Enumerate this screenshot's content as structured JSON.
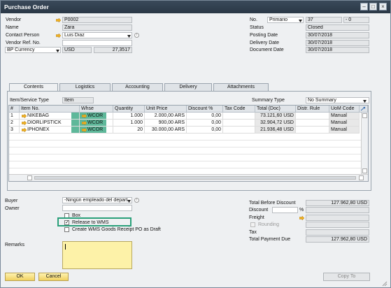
{
  "window": {
    "title": "Purchase Order"
  },
  "header_left": {
    "vendor_label": "Vendor",
    "vendor_value": "P0002",
    "name_label": "Name",
    "name_value": "Zara",
    "contact_label": "Contact Person",
    "contact_value": "Luis Diaz",
    "ref_label": "Vendor Ref. No.",
    "ref_value": "",
    "currency_label": "BP Currency",
    "currency_code": "USD",
    "currency_rate": "27,3517"
  },
  "header_right": {
    "no_label": "No.",
    "series_value": "Primario",
    "no_value": "37",
    "no_suffix": "- 0",
    "status_label": "Status",
    "status_value": "Closed",
    "posting_label": "Posting Date",
    "posting_value": "30/07/2018",
    "delivery_label": "Delivery Date",
    "delivery_value": "30/07/2018",
    "doc_label": "Document Date",
    "doc_value": "30/07/2018"
  },
  "tabs": [
    "Contents",
    "Logistics",
    "Accounting",
    "Delivery",
    "Attachments"
  ],
  "contents": {
    "item_type_label": "Item/Service Type",
    "item_type_value": "Item",
    "summary_label": "Summary Type",
    "summary_value": "No Summary"
  },
  "table": {
    "columns": [
      "#",
      "Item No.",
      "Whse",
      "Quantity",
      "Unit Price",
      "Discount %",
      "Tax Code",
      "Total (Doc)",
      "Distr. Rule",
      "UoM Code"
    ],
    "rows": [
      {
        "n": "1",
        "item": "NIKEBAG",
        "whse": "WCOR",
        "qty": "1.000",
        "price": "2.000,00 ARS",
        "disc": "0,00",
        "tax": "",
        "total": "73.121,60 USD",
        "distr": "",
        "uom": "Manual"
      },
      {
        "n": "2",
        "item": "DIORLIPSTICK",
        "whse": "WCOR",
        "qty": "1.000",
        "price": "900,00 ARS",
        "disc": "0,00",
        "tax": "",
        "total": "32.904,72 USD",
        "distr": "",
        "uom": "Manual"
      },
      {
        "n": "3",
        "item": "IPHONEX",
        "whse": "WCOR",
        "qty": "20",
        "price": "30.000,00 ARS",
        "disc": "0,00",
        "tax": "",
        "total": "21.936,48 USD",
        "distr": "",
        "uom": "Manual"
      }
    ]
  },
  "footer_left": {
    "buyer_label": "Buyer",
    "buyer_value": "-Ningún empleado del depart",
    "owner_label": "Owner",
    "owner_value": "",
    "box_label": "Box",
    "release_label": "Release to WMS",
    "wms_receipt_label": "Create WMS Goods Receipt PO as Draft",
    "remarks_label": "Remarks"
  },
  "footer_right": {
    "total_before_label": "Total Before Discount",
    "total_before_value": "127.962,80 USD",
    "discount_label": "Discount",
    "discount_pct_symbol": "%",
    "freight_label": "Freight",
    "rounding_label": "Rounding",
    "tax_label": "Tax",
    "total_due_label": "Total Payment Due",
    "total_due_value": "127.962,80 USD"
  },
  "buttons": {
    "ok": "OK",
    "cancel": "Cancel",
    "copy_to": "Copy To"
  },
  "colors": {
    "highlight": "#2aa07a",
    "button_yellow": "#f0d060",
    "title_bar": "#2e3c4a"
  }
}
